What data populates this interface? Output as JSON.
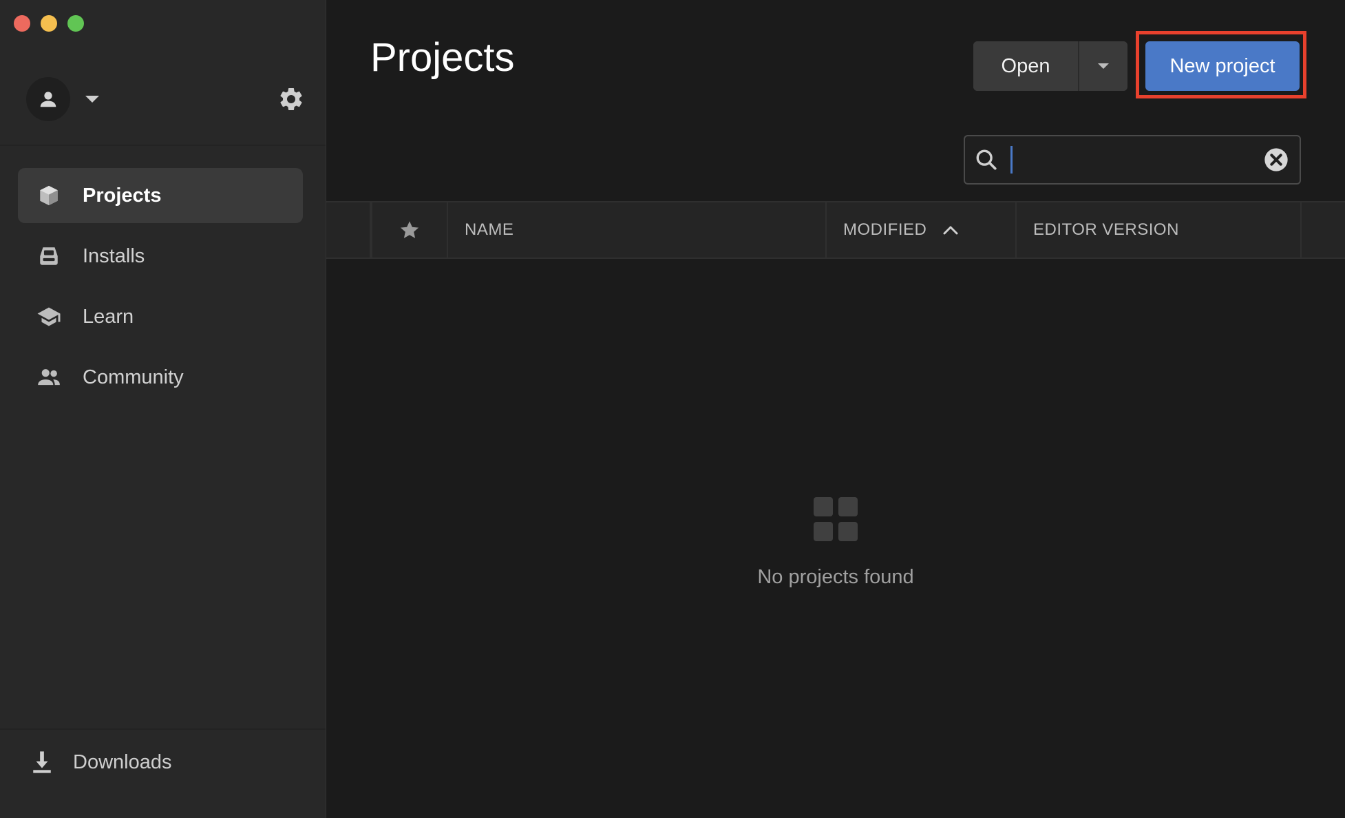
{
  "sidebar": {
    "items": [
      {
        "label": "Projects",
        "icon": "cube-icon",
        "active": true
      },
      {
        "label": "Installs",
        "icon": "installs-icon",
        "active": false
      },
      {
        "label": "Learn",
        "icon": "graduation-cap-icon",
        "active": false
      },
      {
        "label": "Community",
        "icon": "people-icon",
        "active": false
      }
    ],
    "downloads_label": "Downloads"
  },
  "header": {
    "title": "Projects",
    "open_label": "Open",
    "new_project_label": "New project"
  },
  "search": {
    "value": "",
    "placeholder": ""
  },
  "table": {
    "columns": {
      "name": "NAME",
      "modified": "MODIFIED",
      "editor_version": "EDITOR VERSION"
    },
    "sort": {
      "column": "modified",
      "direction": "ascending"
    }
  },
  "empty": {
    "message": "No projects found"
  },
  "colors": {
    "accent": "#4a79c7",
    "highlight": "#e8412d",
    "background": "#1b1b1b",
    "sidebar": "#282828"
  }
}
